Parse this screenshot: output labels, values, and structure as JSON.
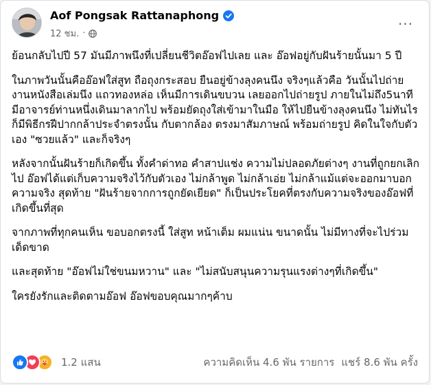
{
  "post": {
    "author": "Aof Pongsak Rattanaphong",
    "time": "12 ชม.",
    "separator": "·",
    "more_label": "···",
    "paragraphs": [
      "ย้อนกลับไปปี 57 มันมีภาพนึงที่เปลี่ยนชีวิตอ๊อฟไปเลย และ อ๊อฟอยู่กับฝันร้ายนั้นมา 5 ปี",
      "ในภาพวันนั้นคืออ๊อฟใส่สูท ถือถุงกระสอบ ยืนอยู่ข้างลุงคนนึง จริงๆแล้วคือ วันนั้นไปถ่ายงานหนังสือเล่มนึง แถวทองหล่อ เห็นมีการเดินขบวน เลยออกไปถ่ายรูป ภายในไม่ถึง5นาที มีอาจารย์ท่านหนึ่งเดินมาลากไป พร้อมยัดถุงใส่เข้ามาในมือ ให้ไปยืนข้างลุงคนนึง ไม่ทันไรก็มีพิธีกรฝีปากกล้าประจำตรงนั้น กับตากล้อง ตรงมาสัมภาษณ์ พร้อมถ่ายรูป คิดในใจกับตัวเอง \"ซวยแล้ว\" และก็จริงๆ",
      "หลังจากนั้นฝันร้ายก็เกิดขึ้น ทั้งคำด่าทอ คำสาปแช่ง ความไม่ปลอดภัยต่างๆ งานที่ถูกยกเลิกไป อ๊อฟได้แต่เก็บความจริงไว้กับตัวเอง ไม่กล้าพูด ไม่กล้าเอ่ย ไม่กล้าแม้แต่จะออกมาบอกความจริง สุดท้าย \"ฝันร้ายจากการถูกยัดเยียด\" ก็เป็นประโยคที่ตรงกับความจริงของอ๊อฟที่เกิดขึ้นที่สุด",
      "จากภาพที่ทุกคนเห็น ขอบอกตรงนี้ ใส่สูท หน้าเต็ม ผมแน่น ขนาดนั้น ไม่มีทางที่จะไปร่วมเด็ดขาด",
      "และสุดท้าย \"อ๊อฟไม่ใช่ขนมหวาน\" และ \"ไม่สนับสนุนความรุนแรงต่างๆที่เกิดขึ้น\"",
      "ใครยังรักและติดตามอ๊อฟ อ๊อฟขอบคุณมากๆค้าบ"
    ]
  },
  "footer": {
    "reaction_count": "1.2 แสน",
    "comments": "ความคิดเห็น 4.6 พัน รายการ",
    "shares": "แชร์ 8.6 พัน ครั้ง"
  },
  "icons": {
    "verified": "verified-badge-icon",
    "privacy": "globe-icon",
    "reactions": [
      "like-icon",
      "love-icon",
      "care-icon"
    ]
  },
  "colors": {
    "accent": "#1877f2",
    "love": "#f33e58",
    "care": "#f7b125",
    "text": "#050505",
    "secondary": "#65676b"
  }
}
